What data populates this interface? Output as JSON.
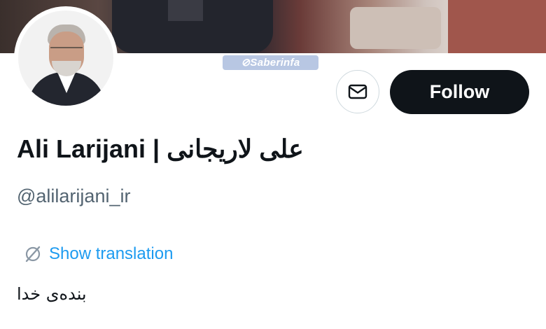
{
  "profile": {
    "display_name": "Ali Larijani | علی لاریجانی",
    "handle": "@alilarijani_ir",
    "bio": "بنده‌ی خدا"
  },
  "actions": {
    "follow_label": "Follow",
    "message_icon": "envelope-icon"
  },
  "translation": {
    "label": "Show translation",
    "icon": "translate-icon"
  },
  "watermark": {
    "text": "⊘Saberinfa"
  },
  "colors": {
    "follow_bg": "#0f1419",
    "link": "#1d9bf0",
    "secondary_text": "#536471"
  }
}
